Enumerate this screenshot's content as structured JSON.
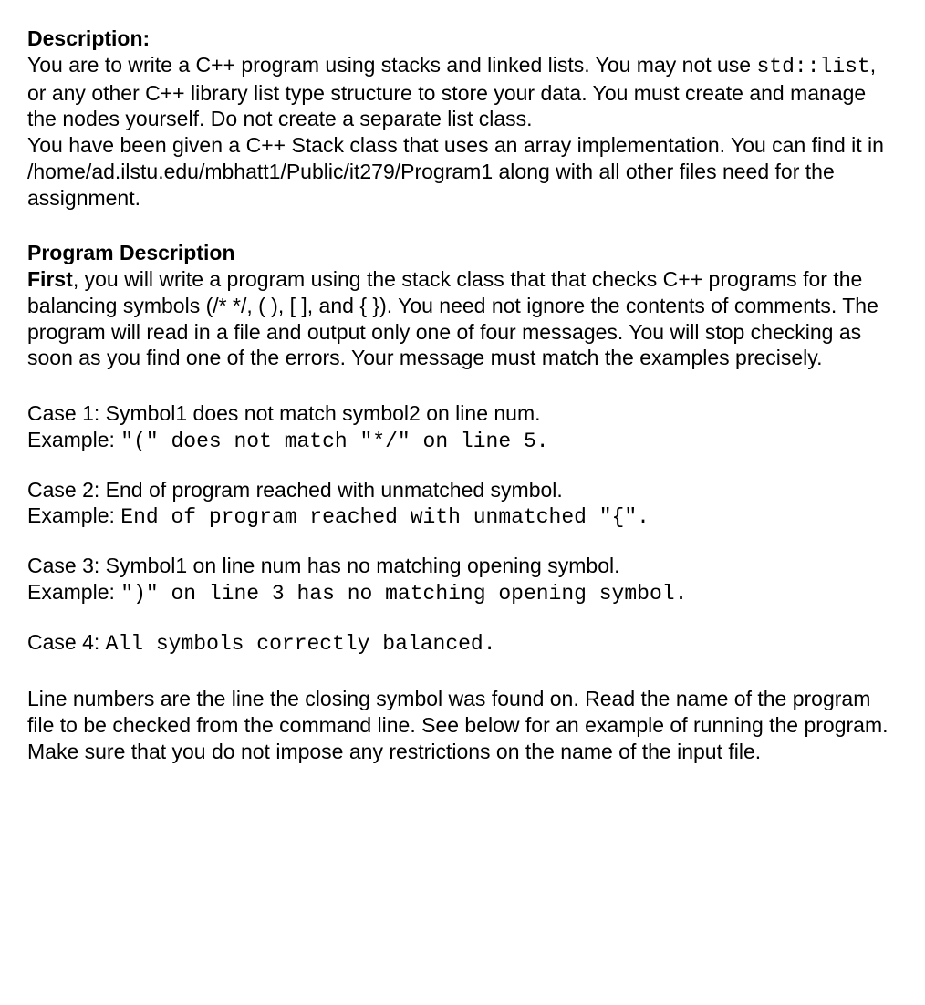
{
  "description": {
    "heading": "Description:",
    "p1_part1": "You are to write a C++ program using stacks and linked lists. You may not use ",
    "p1_code": "std::list",
    "p1_part2": ", or any other C++ library list type structure to store your data. You must create and manage the nodes yourself. Do not create a separate list class.",
    "p2": "You have been given a C++ Stack class that uses an array implementation. You can find it in /home/ad.ilstu.edu/mbhatt1/Public/it279/Program1 along with all other files need for the assignment."
  },
  "program_description": {
    "heading": "Program Description",
    "first_label": "First",
    "first_text": ", you will write a program using the stack class that that checks C++ programs for the balancing symbols (/* */, ( ), [ ], and { }). You need not ignore the contents of comments. The program will read in a file and output only one of four messages. You will stop checking as soon as you find one of the errors. Your message must match the examples precisely."
  },
  "cases": {
    "c1": {
      "line1": "Case 1: Symbol1 does not match symbol2 on line num.",
      "line2_label": "Example: ",
      "line2_code": "\"(\" does not match \"*/\" on line 5."
    },
    "c2": {
      "line1": "Case 2: End of program reached with unmatched symbol.",
      "line2_label": "Example: ",
      "line2_code": "End of program reached with unmatched \"{\"."
    },
    "c3": {
      "line1": "Case 3: Symbol1 on line num has no matching opening symbol.",
      "line2_label": "Example: ",
      "line2_code": "\")\" on line 3 has no matching opening symbol."
    },
    "c4": {
      "line1_label": "Case 4: ",
      "line1_code": "All symbols correctly balanced."
    }
  },
  "footer": {
    "text": "Line numbers are the line the closing symbol was found on. Read the name of the program file to be checked from the command line. See below for an example of running the program. Make sure that you do not impose any restrictions on the name of the input file."
  }
}
